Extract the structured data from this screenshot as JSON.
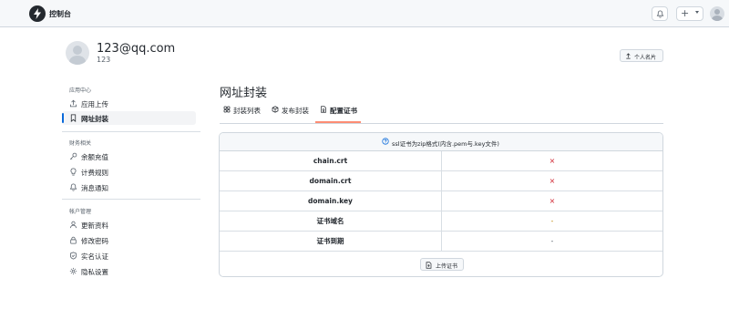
{
  "header": {
    "app_title": "控制台",
    "logo_icon": "bolt-icon",
    "bell_icon": "bell-icon",
    "plus_label": "+"
  },
  "profile": {
    "username": "123@qq.com",
    "user_id": "123",
    "card_button_label": "个人名片"
  },
  "sidebar": {
    "sections": [
      {
        "title": "应用中心",
        "items": [
          {
            "label": "应用上传",
            "icon": "upload-icon",
            "active": false
          },
          {
            "label": "网址封装",
            "icon": "bookmark-icon",
            "active": true
          }
        ]
      },
      {
        "title": "财务相关",
        "items": [
          {
            "label": "余额充值",
            "icon": "key-icon",
            "active": false
          },
          {
            "label": "计费规则",
            "icon": "lightbulb-icon",
            "active": false
          },
          {
            "label": "消息通知",
            "icon": "bell-icon",
            "active": false
          }
        ]
      },
      {
        "title": "帐户管理",
        "items": [
          {
            "label": "更新资料",
            "icon": "person-icon",
            "active": false
          },
          {
            "label": "修改密码",
            "icon": "lock-icon",
            "active": false
          },
          {
            "label": "实名认证",
            "icon": "shield-check-icon",
            "active": false
          },
          {
            "label": "隐私设置",
            "icon": "gear-icon",
            "active": false
          }
        ]
      }
    ]
  },
  "main": {
    "title": "网址封装",
    "tabs": [
      {
        "label": "封装列表",
        "icon": "apps-icon",
        "active": false
      },
      {
        "label": "发布封装",
        "icon": "package-icon",
        "active": false
      },
      {
        "label": "配置证书",
        "icon": "file-badge-icon",
        "active": true
      }
    ],
    "cert": {
      "hint": "ssl证书为zip格式(内含.pem与.key文件)",
      "rows": [
        {
          "name": "chain.crt",
          "value": "×"
        },
        {
          "name": "domain.crt",
          "value": "×"
        },
        {
          "name": "domain.key",
          "value": "×"
        },
        {
          "name": "证书域名",
          "value": "-"
        },
        {
          "name": "证书到期",
          "value": "-"
        }
      ],
      "upload_label": "上传证书"
    }
  },
  "colors": {
    "accent": "#0969da",
    "tab_underline": "#fd8c73",
    "error": "#cf222e",
    "warning": "#bf8700"
  }
}
